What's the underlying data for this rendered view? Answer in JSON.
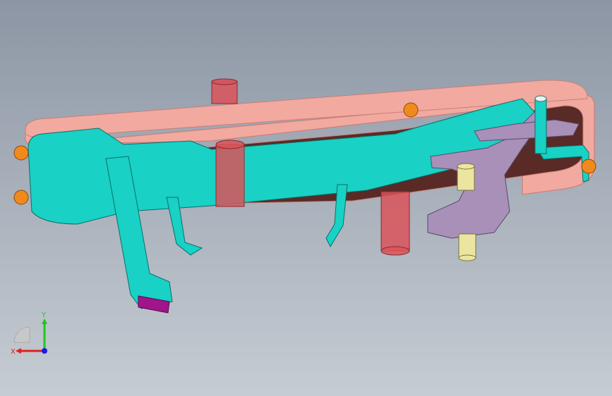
{
  "viewport": {
    "background_top": "#8c96a4",
    "background_bottom": "#c6ccd3"
  },
  "colors": {
    "cover": "#f2a9a0",
    "cover_edge": "#c98078",
    "cavity": "#5a2a26",
    "bracket": "#19d1c4",
    "bracket_edge": "#0a6e68",
    "pin": "#d9545a",
    "lever": "#a890b8",
    "bushing": "#ece5a0",
    "ball": "#f08a1c",
    "end_face": "#a0148c"
  },
  "triad": {
    "x_label": "X",
    "y_label": "Y",
    "x_color": "#e0201c",
    "y_color": "#1cc81c",
    "z_color": "#1c1ce0"
  }
}
